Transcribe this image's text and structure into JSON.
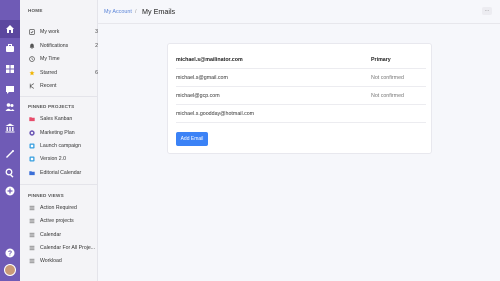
{
  "sidebar": {
    "home_title": "HOME",
    "home_items": [
      {
        "label": "My work",
        "count": "3",
        "icon": "checkbox-icon"
      },
      {
        "label": "Notifications",
        "count": "2",
        "icon": "bell-icon"
      },
      {
        "label": "My Time",
        "count": "",
        "icon": "clock-icon"
      },
      {
        "label": "Starred",
        "count": "6",
        "icon": "star-icon"
      },
      {
        "label": "Recent",
        "count": "",
        "icon": "recent-icon"
      }
    ],
    "projects_title": "PINNED PROJECTS",
    "projects": [
      {
        "label": "Sales Kanban",
        "icon": "folder-icon",
        "color": "#e74c6b"
      },
      {
        "label": "Marketing Plan",
        "icon": "marketing-icon",
        "color": "#6f5bb6"
      },
      {
        "label": "Launch campaign",
        "icon": "launch-icon",
        "color": "#3aa0e0"
      },
      {
        "label": "Version 2.0",
        "icon": "version-icon",
        "color": "#3aa0e0"
      },
      {
        "label": "Editorial Calendar",
        "icon": "folder-icon",
        "color": "#3a6fd8"
      }
    ],
    "views_title": "PINNED VIEWS",
    "views": [
      {
        "label": "Action Required",
        "icon": "view-icon"
      },
      {
        "label": "Active projects",
        "icon": "view-icon"
      },
      {
        "label": "Calendar",
        "icon": "view-icon"
      },
      {
        "label": "Calendar For All Proje...",
        "icon": "view-icon"
      },
      {
        "label": "Workload",
        "icon": "view-icon"
      }
    ]
  },
  "header": {
    "breadcrumb_link": "My Account",
    "breadcrumb_sep": "/",
    "title": "My Emails",
    "menu_glyph": "···"
  },
  "emails": {
    "rows": [
      {
        "email": "michael.s@mailinator.com",
        "status": "Primary",
        "is_primary": true
      },
      {
        "email": "michael.s@gmail.com",
        "status": "Not confirmed",
        "is_primary": false
      },
      {
        "email": "michael@gcp.com",
        "status": "Not confirmed",
        "is_primary": false
      },
      {
        "email": "michael.s.goodday@hotmail.com",
        "status": "",
        "is_primary": false
      }
    ],
    "add_button": "Add Email"
  },
  "colors": {
    "rail": "#6f5bb6",
    "accent_blue": "#3b82f6",
    "link_blue": "#5a84d8"
  }
}
